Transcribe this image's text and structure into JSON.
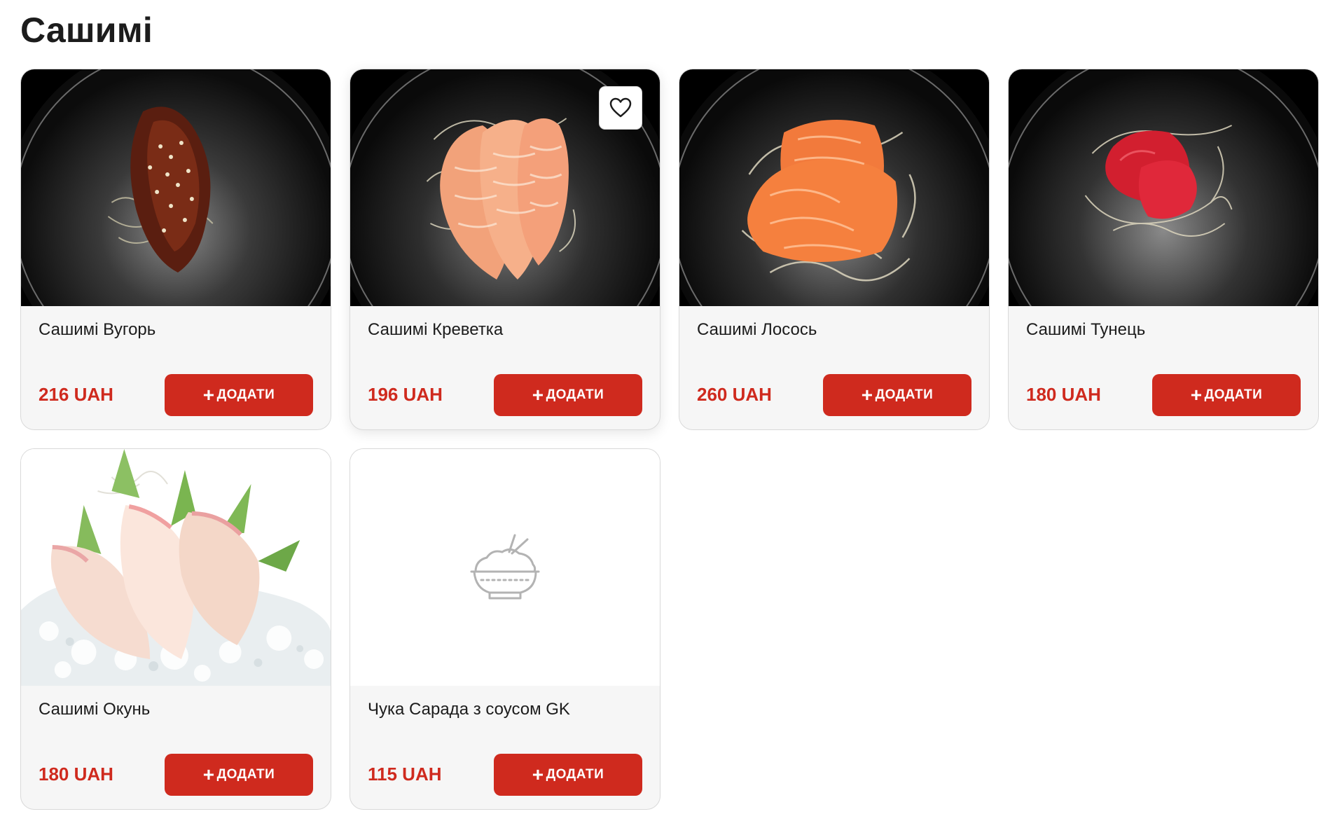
{
  "page": {
    "title": "Сашимі"
  },
  "products": [
    {
      "name": "Сашимі Вугорь",
      "price": "216 UAH",
      "add_label": "ДОДАТИ",
      "image": "eel-sashimi-photo"
    },
    {
      "name": "Сашимі Креветка",
      "price": "196 UAH",
      "add_label": "ДОДАТИ",
      "image": "shrimp-sashimi-photo"
    },
    {
      "name": "Сашимі Лосось",
      "price": "260 UAH",
      "add_label": "ДОДАТИ",
      "image": "salmon-sashimi-photo"
    },
    {
      "name": "Сашимі Тунець",
      "price": "180 UAH",
      "add_label": "ДОДАТИ",
      "image": "tuna-sashimi-photo"
    },
    {
      "name": "Сашимі Окунь",
      "price": "180 UAH",
      "add_label": "ДОДАТИ",
      "image": "perch-sashimi-photo"
    },
    {
      "name": "Чука Сарада з соусом GK",
      "price": "115 UAH",
      "add_label": "ДОДАТИ",
      "image": "bowl-placeholder-icon"
    }
  ],
  "icons": {
    "favorite": "heart-icon",
    "add": "plus-icon",
    "placeholder": "rice-bowl-icon"
  },
  "colors": {
    "accent": "#cf2a1e",
    "card_background": "#f6f6f6",
    "card_border": "#d9d9d9",
    "text": "#1c1c1c"
  }
}
